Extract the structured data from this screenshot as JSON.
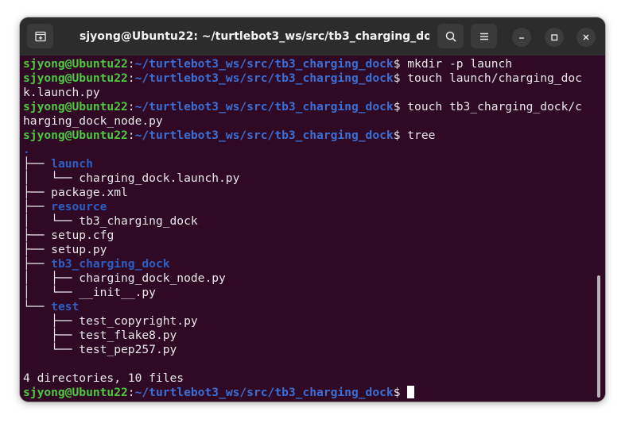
{
  "window": {
    "title": "sjyong@Ubuntu22: ~/turtlebot3_ws/src/tb3_charging_dock",
    "icons": {
      "new_tab": "new-tab-icon",
      "search": "search-icon",
      "menu": "hamburger-menu-icon",
      "minimize": "minimize-icon",
      "maximize": "maximize-icon",
      "close": "close-icon"
    }
  },
  "prompt": {
    "user_host": "sjyong@Ubuntu22",
    "sep": ":",
    "path": "~/turtlebot3_ws/src/tb3_charging_dock",
    "symbol": "$"
  },
  "colors": {
    "background": "#300a24",
    "user_host": "#4ec942",
    "path": "#3a6fd6",
    "directory": "#2c5fc4",
    "text": "#e8e8e8"
  },
  "commands": {
    "cmd1": " mkdir -p launch",
    "cmd2a": " touch launch/charging_doc",
    "cmd2b": "k.launch.py",
    "cmd3a": " touch tb3_charging_dock/c",
    "cmd3b": "harging_dock_node.py",
    "cmd4": " tree"
  },
  "tree": {
    "root": ".",
    "launch_branch": "├── ",
    "launch": "launch",
    "launch_file_branch": "│   └── ",
    "launch_file": "charging_dock.launch.py",
    "package_branch": "├── ",
    "package": "package.xml",
    "resource_branch": "├── ",
    "resource": "resource",
    "resource_file_branch": "│   └── ",
    "resource_file": "tb3_charging_dock",
    "setup_cfg_branch": "├── ",
    "setup_cfg": "setup.cfg",
    "setup_py_branch": "├── ",
    "setup_py": "setup.py",
    "pkg_dir_branch": "├── ",
    "pkg_dir": "tb3_charging_dock",
    "node_branch": "│   ├── ",
    "node": "charging_dock_node.py",
    "init_branch": "│   └── ",
    "init": "__init__.py",
    "test_branch": "└── ",
    "test": "test",
    "copyright_branch": "    ├── ",
    "copyright": "test_copyright.py",
    "flake8_branch": "    ├── ",
    "flake8": "test_flake8.py",
    "pep257_branch": "    └── ",
    "pep257": "test_pep257.py"
  },
  "summary": "4 directories, 10 files"
}
